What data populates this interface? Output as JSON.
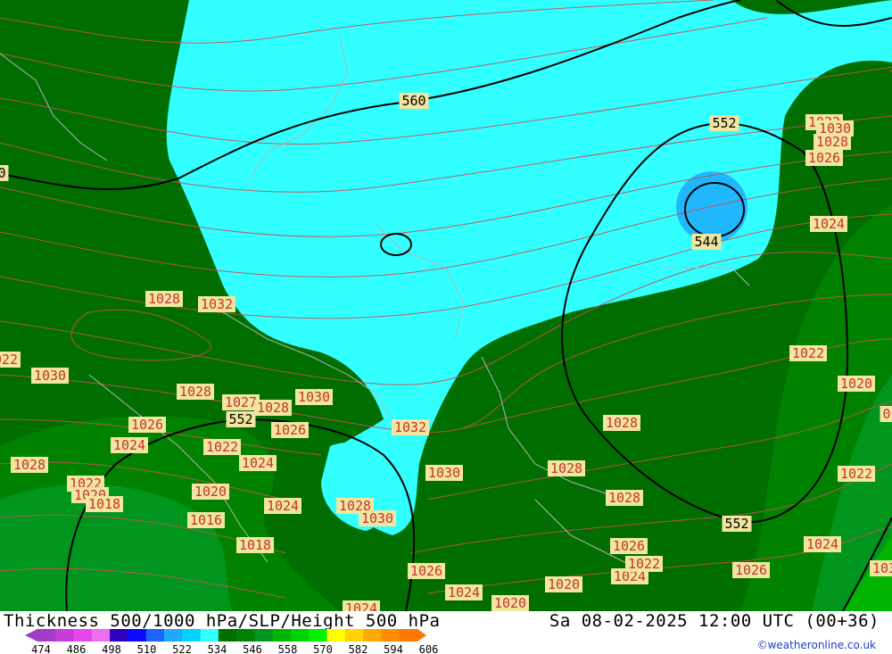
{
  "title": "Thickness 500/1000 hPa/SLP/Height 500 hPa",
  "datetime": "Sa 08-02-2025 12:00 UTC (00+36)",
  "credit": "©weatheronline.co.uk",
  "legend": {
    "colors": [
      "#a03cc8",
      "#c83cdc",
      "#e646f0",
      "#f06ef0",
      "#2d00be",
      "#0a0aff",
      "#1e64ff",
      "#1eaaff",
      "#00d2ff",
      "#32ffff",
      "#006e00",
      "#008200",
      "#00961e",
      "#00b400",
      "#00d200",
      "#00f000",
      "#ffff00",
      "#ffd200",
      "#ffaa00",
      "#ff8c00",
      "#ff7800"
    ],
    "labels": [
      "474",
      "486",
      "498",
      "510",
      "522",
      "534",
      "546",
      "558",
      "570",
      "582",
      "594",
      "606"
    ]
  },
  "map": {
    "colors": {
      "dark_green": "#006e00",
      "mid_green": "#008200",
      "green": "#00961e",
      "light_green": "#00b400",
      "cyan": "#32ffff",
      "blue": "#1eaaff",
      "slp_isobar": "#c85050",
      "border": "#b4b4b4",
      "height_contour": "#000000",
      "slp_label_bg": "#f0e6a0",
      "slp_label_text": "#c83232"
    },
    "height_labels": [
      "560",
      "552",
      "552",
      "552",
      "544",
      "0"
    ],
    "slp_labels": [
      "1028",
      "1032",
      "1030",
      "1028",
      "1027",
      "1028",
      "1030",
      "1026",
      "1024",
      "1022",
      "1024",
      "1026",
      "1022",
      "1020",
      "1018",
      "1020",
      "1016",
      "1024",
      "1018",
      "1028",
      "1030",
      "1032",
      "1030",
      "1026",
      "1024",
      "1028",
      "1020",
      "1024",
      "1032",
      "1030",
      "1028",
      "1026",
      "1024",
      "1022",
      "1020",
      "1028",
      "1028",
      "1028",
      "1026",
      "1022",
      "1024",
      "1026",
      "1022",
      "1024",
      "1020",
      "1030",
      "0",
      "1022",
      "1030"
    ]
  }
}
